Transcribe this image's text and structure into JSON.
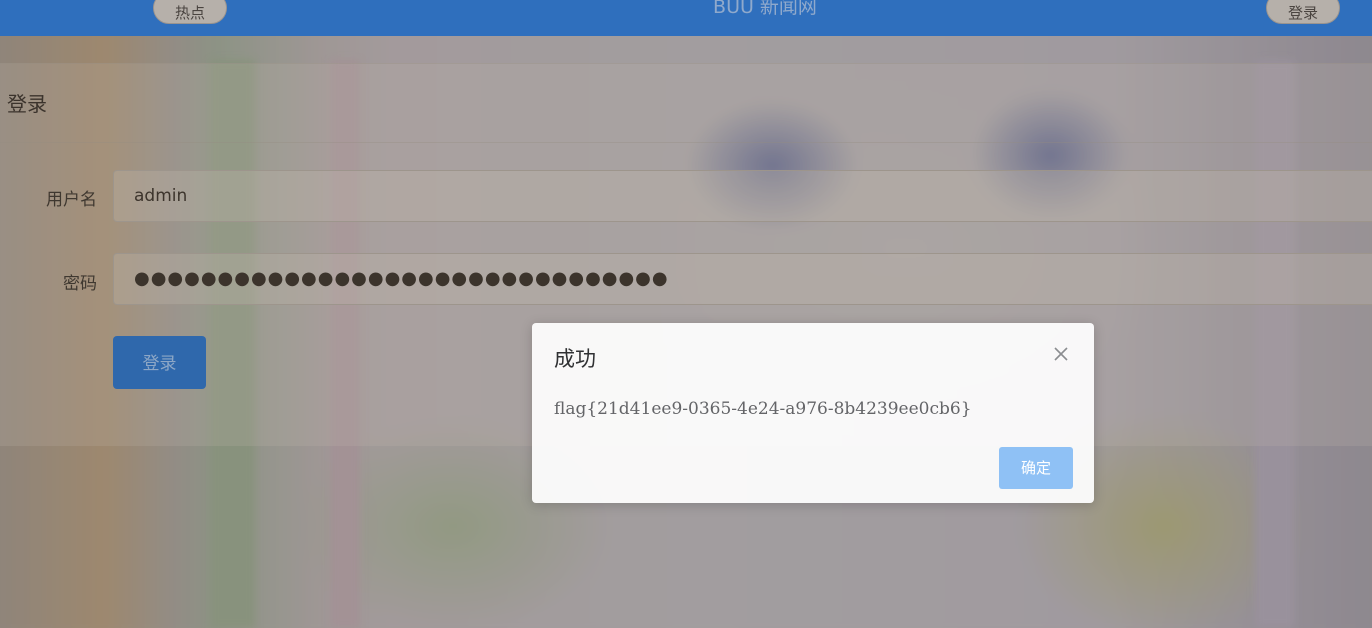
{
  "navbar": {
    "left_button": "热点",
    "title": "BUU 新闻网",
    "right_button": "登录"
  },
  "login_form": {
    "title": "登录",
    "username_label": "用户名",
    "username_value": "admin",
    "password_label": "密码",
    "password_value": "●●●●●●●●●●●●●●●●●●●●●●●●●●●●●●●●",
    "submit_label": "登录"
  },
  "dialog": {
    "title": "成功",
    "message": "flag{21d41ee9-0365-4e24-a976-8b4239ee0cb6}",
    "ok_label": "确定"
  },
  "colors": {
    "navbar": "#2f6fbd",
    "primary_button": "#2f68ac",
    "dialog_ok": "#8fc1f5"
  },
  "icons": {
    "dialog_close": "close-icon"
  }
}
